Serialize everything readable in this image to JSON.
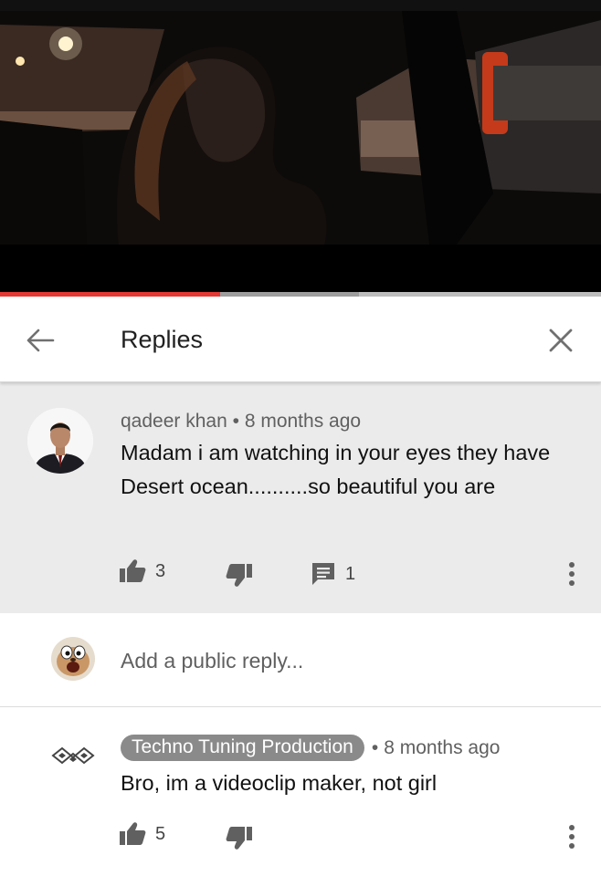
{
  "video": {
    "progress_played_fraction": 0.366,
    "progress_buffered_fraction": 0.597
  },
  "header": {
    "title": "Replies",
    "back_icon": "arrow-left-icon",
    "close_icon": "close-icon"
  },
  "parent_comment": {
    "author": "qadeer khan",
    "separator": "•",
    "time": "8 months ago",
    "text": "Madam i am watching in your eyes they have Desert ocean..........so beautiful you are",
    "likes": "3",
    "replies": "1"
  },
  "add_reply": {
    "placeholder": "Add a public reply..."
  },
  "reply": {
    "author": "Techno Tuning Production",
    "separator": "•",
    "time": "8 months ago",
    "text": "Bro, im a videoclip maker, not girl",
    "likes": "5"
  },
  "colors": {
    "progress_played": "#e53935",
    "comment_highlight_bg": "#ebebeb",
    "author_badge_bg": "#8a8a8a"
  }
}
